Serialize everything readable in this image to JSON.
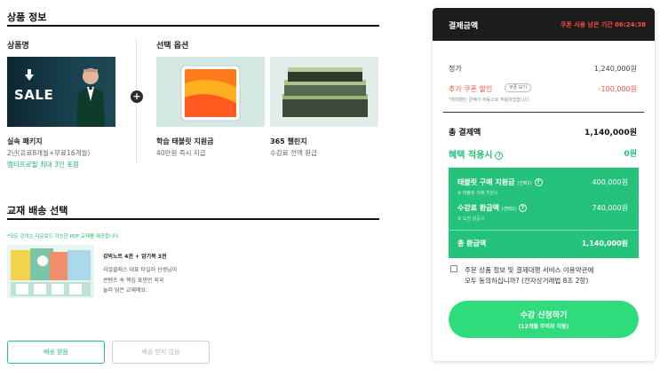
{
  "product_section": {
    "title": "상품 정보",
    "product_col_label": "상품명",
    "options_col_label": "선택 옵션",
    "package": {
      "image_text": "SALE",
      "name": "실속 패키지",
      "desc": "2년(유료8개월+무료16개월)",
      "extra": "멤티프로필 최대 3인 포함"
    },
    "plus_icon": "plus-circle-icon",
    "option_tablet": {
      "name": "학습 태블릿 지원금",
      "desc": "40만원 즉시 지급"
    },
    "option_challenge": {
      "name": "365 챌린지",
      "desc": "수강료 전액 환급"
    }
  },
  "shipping_section": {
    "title": "교재 배송 선택",
    "notice": "*모든 강의는 다운로드 가능한 PDF 교재를 제공합니다.",
    "book_title": "강의노트 4권 + 암기북 3권",
    "book_desc_lines": [
      "리얼클래스 대표 타일러 선생님이",
      "콘텐츠 속 핵심 표현만 꾹꾹",
      "눌러 담은 교재에요."
    ],
    "btn_receive": "배송 받음",
    "btn_no_receive": "배송 받지 않음"
  },
  "payment_panel": {
    "title": "결제금액",
    "coupon_timer": "쿠폰 사용 남은 기간 06:24:38",
    "price_label": "정가",
    "price_value": "1,240,000원",
    "coupon_label": "추가 쿠폰 할인",
    "coupon_view_btn": "쿠폰 보기",
    "coupon_value": "-100,000원",
    "coupon_note": "*최대할인 금액이 자동으로 적용되었습니다.",
    "total_label": "총 결제액",
    "total_value": "1,140,000원",
    "benefit_label": "혜택 적용시",
    "benefit_value": "0원",
    "tablet_label": "태블릿 구매 지원금",
    "tablet_tag": "(선택1)",
    "tablet_note": "※ 태블릿 구매 지원시",
    "tablet_value": "400,000원",
    "refund_label": "수강료 환급액",
    "refund_tag": "(선택2)",
    "refund_note": "※ 도전 성공시",
    "refund_value": "740,000원",
    "total_refund_label": "총 환급액",
    "total_refund_value": "1,140,000원",
    "agree_line1": "주문 상품 정보 및 결제대행 서비스 이용약관에",
    "agree_line2": "모두 동의하십니까? (전자상거래법 8조 2항)",
    "cta_main": "수강 신청하기",
    "cta_sub": "(12개월 무이자 지원)"
  },
  "colors": {
    "accent_green": "#24c27a",
    "cta_green": "#2fdc7b",
    "alert_red": "#ff4d3d",
    "header_dark": "#1c1c1c"
  }
}
